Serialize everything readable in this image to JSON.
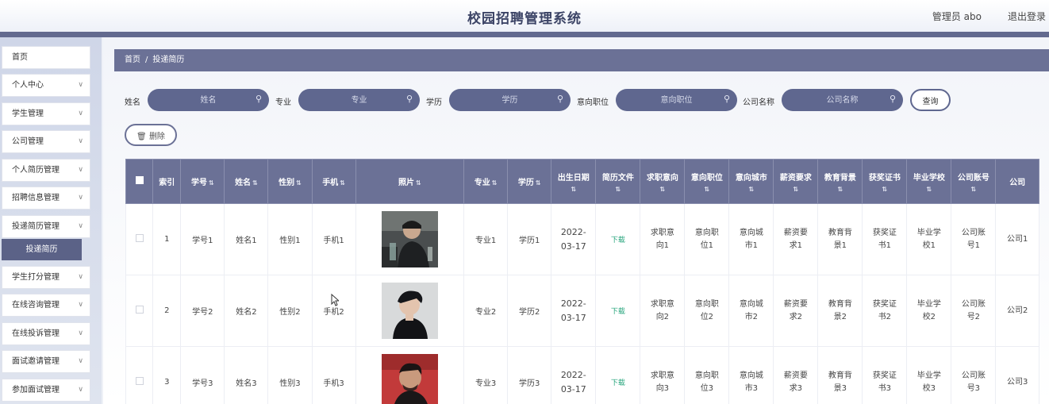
{
  "header": {
    "title": "校园招聘管理系统",
    "user": "管理员 abo",
    "logout": "退出登录"
  },
  "sidebar": {
    "items": [
      {
        "label": "首页",
        "chevron": false
      },
      {
        "label": "个人中心",
        "chevron": true
      },
      {
        "label": "学生管理",
        "chevron": true
      },
      {
        "label": "公司管理",
        "chevron": true
      },
      {
        "label": "个人简历管理",
        "chevron": true
      },
      {
        "label": "招聘信息管理",
        "chevron": true
      },
      {
        "label": "投递简历管理",
        "chevron": true
      },
      {
        "label": "学生打分管理",
        "chevron": true
      },
      {
        "label": "在线咨询管理",
        "chevron": true
      },
      {
        "label": "在线投诉管理",
        "chevron": true
      },
      {
        "label": "面试邀请管理",
        "chevron": true
      },
      {
        "label": "参加面试管理",
        "chevron": true
      }
    ],
    "active_sub": "投递简历"
  },
  "breadcrumb": {
    "home": "首页",
    "sep": "/",
    "current": "投递简历"
  },
  "search": {
    "fields": [
      {
        "label": "姓名",
        "placeholder": "姓名"
      },
      {
        "label": "专业",
        "placeholder": "专业"
      },
      {
        "label": "学历",
        "placeholder": "学历"
      },
      {
        "label": "意向职位",
        "placeholder": "意向职位"
      },
      {
        "label": "公司名称",
        "placeholder": "公司名称"
      }
    ],
    "query_button": "查询"
  },
  "toolbar": {
    "delete_label": "删除"
  },
  "table": {
    "columns": [
      "索引",
      "学号",
      "姓名",
      "性别",
      "手机",
      "照片",
      "专业",
      "学历",
      "出生日期",
      "简历文件",
      "求职意向",
      "意向职位",
      "意向城市",
      "薪资要求",
      "教育背景",
      "获奖证书",
      "毕业学校",
      "公司账号",
      "公司"
    ],
    "rows": [
      {
        "index": "1",
        "xh": "学号1",
        "name": "姓名1",
        "gender": "性别1",
        "phone": "手机1",
        "major": "专业1",
        "edu": "学历1",
        "birth": "2022-03-17",
        "file": "下载",
        "qzyx": "求职意向1",
        "yxzw": "意向职位1",
        "yxcs": "意向城市1",
        "xzyq": "薪资要求1",
        "jybj": "教育背景1",
        "hjzs": "获奖证书1",
        "byxx": "毕业学校1",
        "gszh": "公司账号1",
        "gs": "公司1"
      },
      {
        "index": "2",
        "xh": "学号2",
        "name": "姓名2",
        "gender": "性别2",
        "phone": "手机2",
        "major": "专业2",
        "edu": "学历2",
        "birth": "2022-03-17",
        "file": "下载",
        "qzyx": "求职意向2",
        "yxzw": "意向职位2",
        "yxcs": "意向城市2",
        "xzyq": "薪资要求2",
        "jybj": "教育背景2",
        "hjzs": "获奖证书2",
        "byxx": "毕业学校2",
        "gszh": "公司账号2",
        "gs": "公司2"
      },
      {
        "index": "3",
        "xh": "学号3",
        "name": "姓名3",
        "gender": "性别3",
        "phone": "手机3",
        "major": "专业3",
        "edu": "学历3",
        "birth": "2022-03-17",
        "file": "下载",
        "qzyx": "求职意向3",
        "yxzw": "意向职位3",
        "yxcs": "意向城市3",
        "xzyq": "薪资要求3",
        "jybj": "教育背景3",
        "hjzs": "获奖证书3",
        "byxx": "毕业学校3",
        "gszh": "公司账号3",
        "gs": "公司3"
      }
    ]
  },
  "icons": {
    "search": "search-icon",
    "trash": "trash-icon",
    "sort": "sort-icon",
    "chevron": "chevron-down-icon"
  },
  "colors": {
    "accent": "#6b7196",
    "input_bg": "#5f678f",
    "download": "#23a37a"
  }
}
